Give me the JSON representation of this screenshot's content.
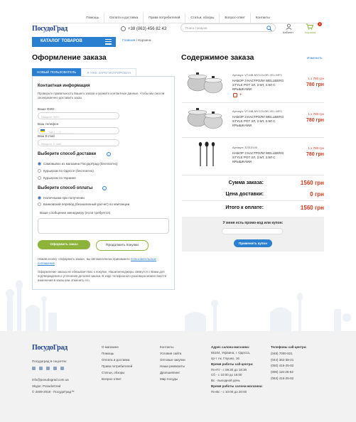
{
  "topnav": [
    "Помощь",
    "Оплата и доставка",
    "Права потребителей",
    "Статьи, обзоры",
    "Вопрос-ответ",
    "Контакты"
  ],
  "header": {
    "logo": "ПосудоГрад",
    "phone": "+38 (063) 456 82 43",
    "search_placeholder": "Поиск товаров",
    "cabinet": "Кабинет",
    "cart": "Корзина",
    "cart_count": "2"
  },
  "catalog_label": "КАТАЛОГ ТОВАРОВ",
  "breadcrumb": {
    "home": "Главная",
    "sep": " / ",
    "current": "Корзина"
  },
  "checkout": {
    "title": "Оформление заказа",
    "tab_new": "НОВЫЙ ПОЛЬЗОВАТЕЛЬ",
    "tab_registered": "Я УЖЕ ЗАРЕГИСТРИРОВАН",
    "contact_title": "Контактная информация",
    "contact_hint": "Проверьте правильность Вашего заказа и укажите контактные данные, чтобы мы смогли своевременно доставить заказ.",
    "name_label": "Ваше ФИО",
    "name_placeholder": "Введите ФИО",
    "phone_label": "Ваш телефон",
    "phone_placeholder": "+38 (___) ___-__-__",
    "email_label": "Ваш E-mail",
    "email_placeholder": "Введите E-mail",
    "delivery_title": "Выберите способ доставки",
    "delivery_options": [
      "Самовывоз из магазина ПосудоГрад (бесплатно)",
      "Курьером по Одессе (бесплатно)",
      "Курьером по Украине"
    ],
    "payment_title": "Выберите способ оплаты",
    "payment_options": [
      "Наличными при получении",
      "Банковский перевод (безналичный расчет) по квитанции"
    ],
    "comment_label": "Ваше сообщение менеджеру (если требуется)",
    "submit": "Оформить заказ",
    "continue": "Продолжить покупки",
    "agree_text": "Нажав кнопку «Оформить заказ», вы автоматически принимаете",
    "agree_link": "пользовательское соглашение",
    "note": "Оформление заказа не обязывает Вас к покупке. Наши менеджеры свяжутся с Вами для подтверждения и уточнения деталей заказа. В ходе телефонного разговора можно внести изменения в заказ или отменить его."
  },
  "order": {
    "title": "Содержимое заказа",
    "edit": "Изменить",
    "items": [
      {
        "article": "Артикул: VT-MB-MYCOLOR-YEL-WF3",
        "name": "НАБОР 3 КАСТРОЛИ WELLBERG STYLE POT 2Л, 2.9Л, 3.9Л С КРЫШКАМИ",
        "qty": "1 x 780 грн",
        "price": "780 грн"
      },
      {
        "article": "Артикул: VT-MB-MYCOLOR-YEL-WF3",
        "name": "НАБОР 3 КАСТРОЛИ WELLBERG STYLE POT 2Л, 2.9Л, 3.9Л С КРЫШКАМИ",
        "qty": "1 x 780 грн",
        "price": "780 грн"
      },
      {
        "article": "Артикул: 32313140",
        "name": "НАБОР 3 КАСТРОЛИ WELLBERG STYLE POT 2Л, 2.9Л, 3.9Л С КРЫШКАМИ",
        "qty": "1 x 780 грн",
        "price": "780 грн"
      }
    ],
    "sum_label": "Сумма заказа:",
    "sum_value": "1560 грн",
    "delivery_label": "Цена доставки:",
    "delivery_value": "0 грн",
    "total_label": "Итого к оплате:",
    "total_value": "1560 грн",
    "promo_title": "У меня есть промо-код или купон:",
    "promo_button": "Применить купон"
  },
  "footer": {
    "logo": "ПосудоГрад",
    "social": "Посудоград в соцсетях:",
    "email": "info@posudograd.com.ua",
    "skype": "Skype: PosudoGrad",
    "copyright": "© 2009-2018 - ПосудоГрад™",
    "col1": [
      "О магазине",
      "Помощь",
      "Оплата и доставка",
      "Права потребителей",
      "Статьи, обзоры",
      "Вопрос-ответ"
    ],
    "col2": [
      "Контакты",
      "Условия сайта",
      "Оптовые закупки",
      "Наши реквизиты",
      "Дропшиппинг",
      "Мир посуды"
    ],
    "addr_title": "Адрес салона-магазина:",
    "addr": [
      "65104, Украина, г. Одесса,",
      "пр-т Ак. Глушко, 16"
    ],
    "hours_title": "Время работы call-центра:",
    "hours": [
      "Пн-Пт - с 09:30 до 18:30",
      "Сб - с 10:00 до 16:00",
      "Вс - выходной день"
    ],
    "shop_hours_title": "Время работы салона-магазина:",
    "shop_hours": [
      "Пн-Вс - с 10:00 до 20:00"
    ],
    "phones_title": "Телефоны call-центра:",
    "phones": [
      "(048) 7000-821",
      "(044) 362-38-21",
      "(050) 416-25-82",
      "(096) 116-25-82",
      "(063) 416-25-82"
    ]
  },
  "colors": {
    "accent": "#2b7fd0",
    "price": "#d23c1e",
    "green": "#8db33a",
    "brand": "#1f3f8f"
  }
}
